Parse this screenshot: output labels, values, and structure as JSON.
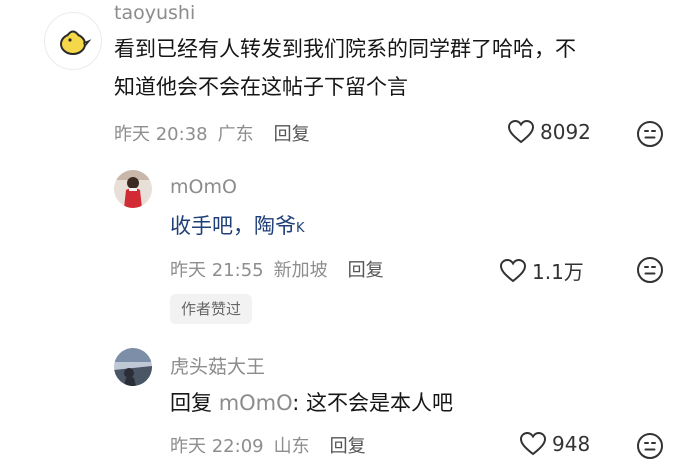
{
  "comments": [
    {
      "username": "taoyushi",
      "text_line1": "看到已经有人转发到我们院系的同学群了哈哈，不",
      "text_line2": "知道他会不会在这帖子下留个言",
      "time": "昨天 20:38",
      "location": "广东",
      "reply_label": "回复",
      "likes": "8092",
      "avatar_icon": "yellow-chick-icon"
    },
    {
      "username": "mOmO",
      "text": "收手吧，陶爷",
      "time": "昨天 21:55",
      "location": "新加坡",
      "reply_label": "回复",
      "likes": "1.1万",
      "badge": "作者赞过",
      "avatar_icon": "photo-avatar"
    },
    {
      "username": "虎头菇大王",
      "reply_prefix": "回复",
      "reply_to": "mOmO",
      "text": ": 这不会是本人吧",
      "time": "昨天 22:09",
      "location": "山东",
      "reply_label": "回复",
      "likes": "948",
      "avatar_icon": "photo-avatar"
    }
  ],
  "colors": {
    "username": "#8c8c8c",
    "text": "#161616",
    "meta": "#8e8e8e",
    "author_reply_blue": "#1f3f78",
    "chick_yellow": "#f5d74a"
  }
}
